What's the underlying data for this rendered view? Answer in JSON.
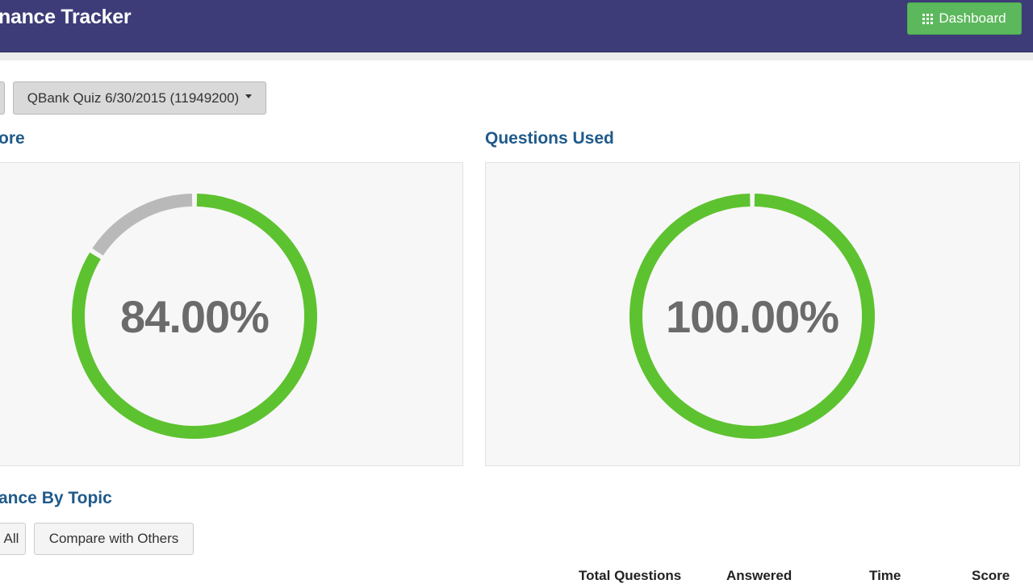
{
  "header": {
    "title": "nance Tracker",
    "dashboard_label": "Dashboard",
    "dashboard_icon": "grid-icon"
  },
  "toolbar": {
    "quiz_select_value": "QBank Quiz 6/30/2015 (11949200)"
  },
  "score_card": {
    "heading": "ore",
    "value_text": "84.00%",
    "percent": 84,
    "fill_color": "#5dc22f",
    "remainder_color": "#b9b9b9"
  },
  "questions_card": {
    "heading": "Questions Used",
    "value_text": "100.00%",
    "percent": 100,
    "fill_color": "#5dc22f"
  },
  "topic_section": {
    "heading": "ance By Topic",
    "all_button": "All",
    "compare_button": "Compare with Others",
    "columns": [
      "Total Questions",
      "Answered",
      "Time",
      "Score"
    ]
  }
}
